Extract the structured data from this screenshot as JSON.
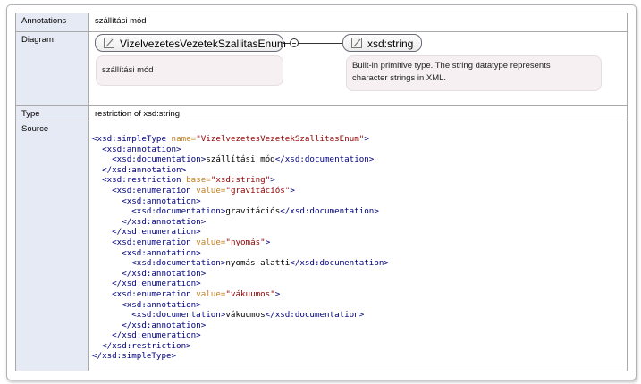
{
  "rows": {
    "annotations": {
      "label": "Annotations",
      "value": "szállítási mód"
    },
    "diagram": {
      "label": "Diagram"
    },
    "type": {
      "label": "Type",
      "value": "restriction of xsd:string"
    },
    "source": {
      "label": "Source"
    }
  },
  "diagram": {
    "enum_box": "VizelvezetesVezetekSzallitasEnum",
    "enum_doc": "szállítási mód",
    "base_box": "xsd:string",
    "base_doc_line1": "Built-in primitive type. The string datatype represents",
    "base_doc_line2": "character strings in XML."
  },
  "source": {
    "type_name": "VizelvezetesVezetekSzallitasEnum",
    "documentation": "szállítási mód",
    "restriction_base": "xsd:string",
    "enumerations": [
      {
        "value": "gravitációs",
        "doc": "gravitációs"
      },
      {
        "value": "nyomás",
        "doc": "nyomás alatti"
      },
      {
        "value": "vákuumos",
        "doc": "vákuumos"
      }
    ]
  }
}
